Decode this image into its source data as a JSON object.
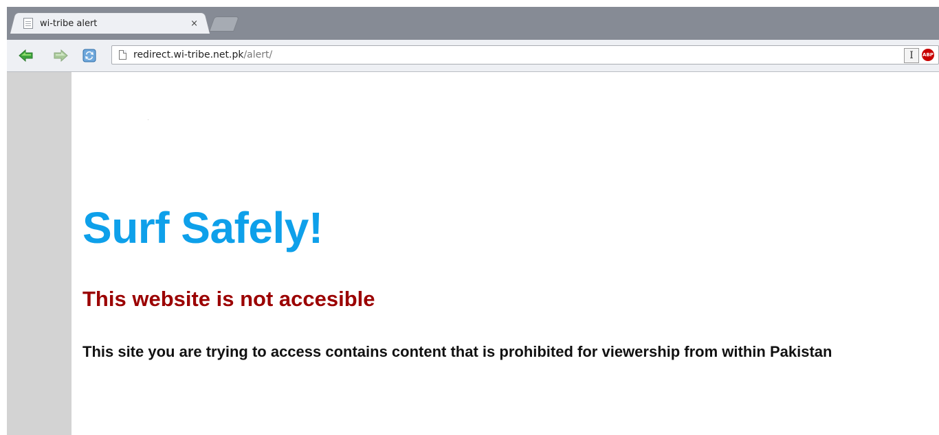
{
  "browser": {
    "tab": {
      "title": "wi-tribe alert",
      "close_label": "×"
    },
    "toolbar": {
      "url_host": "redirect.wi-tribe.net.pk",
      "url_path": "/alert/",
      "ext_ibeam_label": "I",
      "ext_abp_label": "ABP"
    }
  },
  "page": {
    "headline": "Surf Safely!",
    "subheadline": "This website is not accesible",
    "message": "This site you are trying to access contains content that is prohibited for viewership from within Pakistan"
  },
  "colors": {
    "headline": "#0ea0ea",
    "subheadline": "#9b0000",
    "message": "#111111",
    "sidebar": "#d3d3d3",
    "tabstrip": "#868b95"
  }
}
